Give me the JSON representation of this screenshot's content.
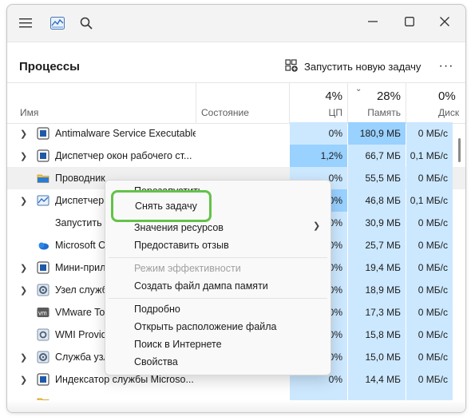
{
  "header": {
    "title": "Процессы",
    "run_task_label": "Запустить новую задачу",
    "more_label": "···"
  },
  "columns": {
    "name": "Имя",
    "status": "Состояние",
    "cpu": {
      "percent": "4%",
      "label": "ЦП"
    },
    "memory": {
      "percent": "28%",
      "label": "Память"
    },
    "disk": {
      "percent": "0%",
      "label": "Диск"
    }
  },
  "processes": [
    {
      "name": "Antimalware Service Executable",
      "cpu": "0%",
      "mem": "180,9 МБ",
      "disk": "0 МБ/с",
      "icon": "defender-icon"
    },
    {
      "name": "Диспетчер окон рабочего ст...",
      "cpu": "1,2%",
      "mem": "66,7 МБ",
      "disk": "0,1 МБ/с",
      "icon": "window-icon"
    },
    {
      "name": "Проводник",
      "cpu": "0%",
      "mem": "55,5 МБ",
      "disk": "0 МБ/с",
      "icon": "folder-icon"
    },
    {
      "name": "Диспетчер з",
      "cpu": "0%",
      "mem": "46,8 МБ",
      "disk": "0,1 МБ/с",
      "icon": "chart-icon"
    },
    {
      "name": "Запустить (",
      "cpu": "0%",
      "mem": "30,9 МБ",
      "disk": "0 МБ/с",
      "icon": ""
    },
    {
      "name": "Microsoft O",
      "cpu": "0%",
      "mem": "25,7 МБ",
      "disk": "0 МБ/с",
      "icon": "cloud-icon"
    },
    {
      "name": "Мини-прил",
      "cpu": "0%",
      "mem": "19,4 МБ",
      "disk": "0 МБ/с",
      "icon": "widgets-icon"
    },
    {
      "name": "Узел служб",
      "cpu": "0%",
      "mem": "18,9 МБ",
      "disk": "0 МБ/с",
      "icon": "gear-icon"
    },
    {
      "name": "VMware Too",
      "cpu": "0%",
      "mem": "17,3 МБ",
      "disk": "0 МБ/с",
      "icon": "vmware-icon"
    },
    {
      "name": "WMI Provid",
      "cpu": "0%",
      "mem": "15,8 МБ",
      "disk": "0 МБ/с",
      "icon": "wmi-icon"
    },
    {
      "name": "Служба узл",
      "cpu": "0%",
      "mem": "15,0 МБ",
      "disk": "0 МБ/с",
      "icon": "gear-icon"
    },
    {
      "name": "Индексатор службы Microso...",
      "cpu": "0%",
      "mem": "14,4 МБ",
      "disk": "0 МБ/с",
      "icon": "indexer-icon"
    }
  ],
  "menu": {
    "restart": "Перезапустить",
    "end_task": "Снять задачу",
    "resource_values": "Значения ресурсов",
    "feedback": "Предоставить отзыв",
    "efficiency": "Режим эффективности",
    "dump": "Создать файл дампа памяти",
    "details": "Подробно",
    "open_location": "Открыть расположение файла",
    "search_web": "Поиск в Интернете",
    "properties": "Свойства"
  },
  "colors": {
    "cpu_fill": "#cce8ff",
    "cpu_fill_strong": "#99d1ff",
    "highlight": "#63c24a"
  }
}
